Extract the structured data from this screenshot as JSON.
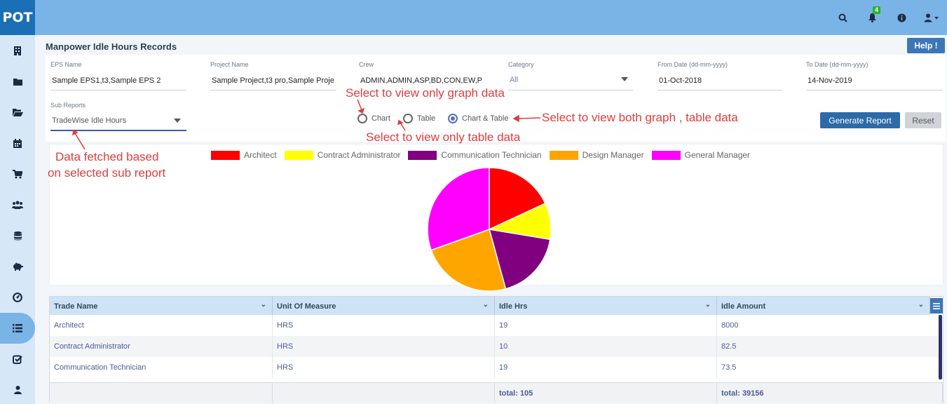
{
  "app": {
    "logo": "POT",
    "notification_count": "4"
  },
  "page": {
    "title": "Manpower Idle Hours Records",
    "help_label": "Help !"
  },
  "filters": {
    "eps_name": {
      "label": "EPS Name",
      "value": "Sample EPS1,t3,Sample EPS 2"
    },
    "project_name": {
      "label": "Project Name",
      "value": "Sample Project,t3 pro,Sample Proje"
    },
    "crew": {
      "label": "Crew",
      "value": "ADMIN,ADMIN,ASP,BD,CON,EW,P"
    },
    "category": {
      "label": "Category",
      "value": "All"
    },
    "from_date": {
      "label": "From Date (dd-mm-yyyy)",
      "value": "01-Oct-2018"
    },
    "to_date": {
      "label": "To Date (dd-mm-yyyy)",
      "value": "14-Nov-2019"
    },
    "sub_reports": {
      "label": "Sub Reports",
      "value": "TradeWise Idle Hours"
    }
  },
  "view_mode": {
    "options": [
      "Chart",
      "Table",
      "Chart & Table"
    ],
    "selected": "Chart & Table"
  },
  "actions": {
    "generate_label": "Generate Report",
    "reset_label": "Reset"
  },
  "annotations": {
    "graph_only": "Select to view only graph data",
    "table_only": "Select to view only table data",
    "both": "Select to view both graph , table data",
    "sub_report_line1": "Data fetched based",
    "sub_report_line2": "on selected sub report"
  },
  "colors": {
    "accent": "#3c76b8",
    "header_bar": "#7ab4e6",
    "annotation": "#e33b3b"
  },
  "sidebar_icons": [
    "building-icon",
    "folder-icon",
    "folder-open-icon",
    "calendar-icon",
    "cart-icon",
    "users-icon",
    "database-icon",
    "piggy-bank-icon",
    "dashboard-icon",
    "list-icon",
    "checklist-icon",
    "user-icon"
  ],
  "chart_data": {
    "type": "pie",
    "series": [
      {
        "name": "Architect",
        "value": 19,
        "color": "#ff0000"
      },
      {
        "name": "Contract Administrator",
        "value": 10,
        "color": "#ffff00"
      },
      {
        "name": "Communication Technician",
        "value": 19,
        "color": "#800080"
      },
      {
        "name": "Design Manager",
        "value": 25,
        "color": "#ffa500"
      },
      {
        "name": "General Manager",
        "value": 32,
        "color": "#ff00ff"
      }
    ],
    "legend": "top"
  },
  "table": {
    "columns": [
      "Trade Name",
      "Unit Of Measure",
      "Idle Hrs",
      "Idle Amount"
    ],
    "rows": [
      [
        "Architect",
        "HRS",
        "19",
        "8000"
      ],
      [
        "Contract Administrator",
        "HRS",
        "10",
        "82.5"
      ],
      [
        "Communication Technician",
        "HRS",
        "19",
        "73.5"
      ]
    ],
    "footer": {
      "idle_hrs_total": "total: 105",
      "idle_amount_total": "total: 39156"
    }
  }
}
